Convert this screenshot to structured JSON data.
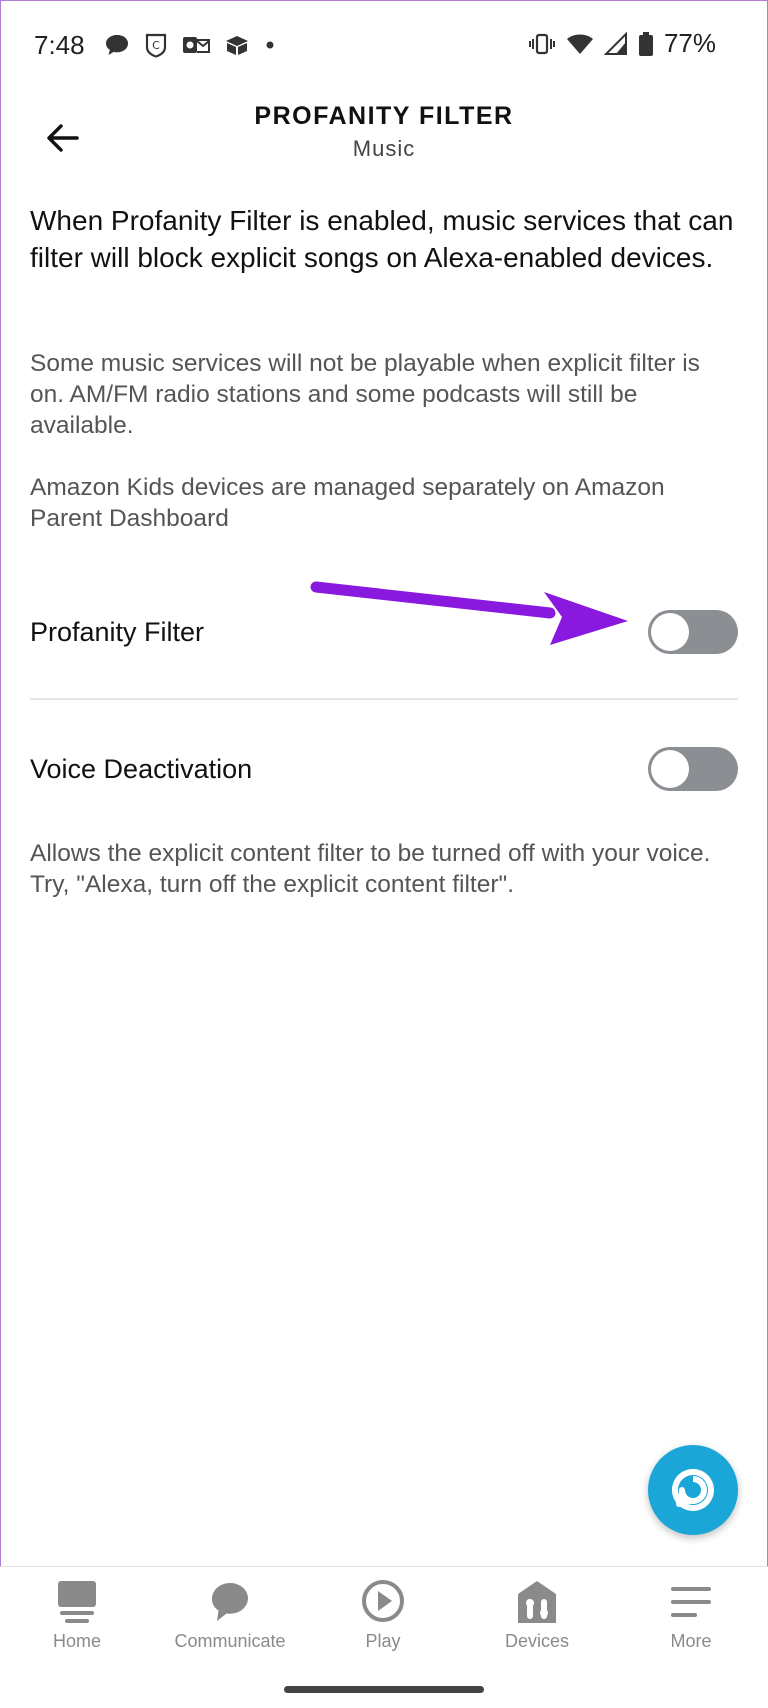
{
  "status_bar": {
    "time": "7:48",
    "battery": "77%",
    "icons_left": [
      "chat-bubble-icon",
      "shield-app-icon",
      "outlook-icon",
      "box-icon",
      "dot-icon"
    ],
    "icons_right": [
      "vibrate-icon",
      "wifi-icon",
      "signal-icon",
      "battery-icon"
    ]
  },
  "header": {
    "title": "PROFANITY FILTER",
    "subtitle": "Music",
    "back_icon": "arrow-left-icon"
  },
  "main": {
    "intro": "When Profanity Filter is enabled, music services that can filter will block explicit songs on Alexa-enabled devices.",
    "note_services": "Some music services will not be playable when explicit filter is on. AM/FM radio stations and some podcasts will still be available.",
    "note_kids": "Amazon Kids devices are managed separately on Amazon Parent Dashboard",
    "settings": [
      {
        "label": "Profanity Filter",
        "enabled": false
      },
      {
        "label": "Voice Deactivation",
        "enabled": false
      }
    ],
    "voice_description": "Allows the explicit content filter to be turned off with your voice. Try, \"Alexa, turn off the explicit content filter\"."
  },
  "annotation": {
    "arrow_color": "#8a19e0"
  },
  "colors": {
    "toggle_off": "#8b8f93",
    "alexa_blue": "#1aa7d8",
    "nav_inactive": "#8a8a8a"
  },
  "bottom_nav": {
    "items": [
      {
        "label": "Home",
        "icon": "home-icon"
      },
      {
        "label": "Communicate",
        "icon": "chat-icon"
      },
      {
        "label": "Play",
        "icon": "play-icon"
      },
      {
        "label": "Devices",
        "icon": "devices-icon"
      },
      {
        "label": "More",
        "icon": "menu-icon"
      }
    ]
  },
  "alexa_button": {
    "icon": "alexa-icon"
  }
}
